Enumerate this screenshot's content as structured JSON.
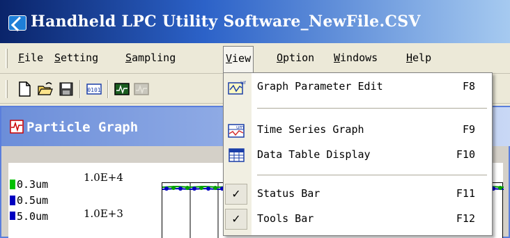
{
  "window": {
    "title": "Handheld LPC Utility Software_NewFile.CSV"
  },
  "menubar": {
    "items": [
      {
        "label": "File",
        "underline": "F"
      },
      {
        "label": "Setting",
        "underline": "S"
      },
      {
        "label": "Sampling",
        "underline": "S"
      },
      {
        "label": "View",
        "underline": "V"
      },
      {
        "label": "Option",
        "underline": "O"
      },
      {
        "label": "Windows",
        "underline": "W"
      },
      {
        "label": "Help",
        "underline": "H"
      }
    ],
    "active": "View"
  },
  "toolbar": {
    "buttons": [
      "new-file-icon",
      "open-folder-icon",
      "save-disk-icon",
      "data-table-icon",
      "graph-monitor-icon",
      "disabled-graph-icon"
    ]
  },
  "child_window": {
    "title": "Particle Graph",
    "legend": [
      {
        "label": "0.3um",
        "color": "#00c000"
      },
      {
        "label": "0.5um",
        "color": "#0000c0"
      },
      {
        "label": "5.0um",
        "color": "#0000c0"
      }
    ],
    "y_ticks": [
      "1.0E+4",
      "1.0E+3"
    ]
  },
  "view_menu": {
    "items": [
      {
        "label": "Graph Parameter Edit",
        "shortcut": "F8",
        "icon": "graph-param-edit-icon"
      },
      {
        "label": "Time Series Graph",
        "shortcut": "F9",
        "icon": "time-series-graph-icon"
      },
      {
        "label": "Data Table Display",
        "shortcut": "F10",
        "icon": "data-table-display-icon"
      },
      {
        "label": "Status Bar",
        "shortcut": "F11",
        "checked": true
      },
      {
        "label": "Tools Bar",
        "shortcut": "F12",
        "checked": true
      }
    ],
    "check_glyph": "✓"
  },
  "colors": {
    "title_gradient_start": "#0a246a",
    "title_gradient_end": "#a6caf0",
    "menu_background": "#ece9d8",
    "legend_green": "#00c000",
    "legend_blue": "#0000c0"
  }
}
